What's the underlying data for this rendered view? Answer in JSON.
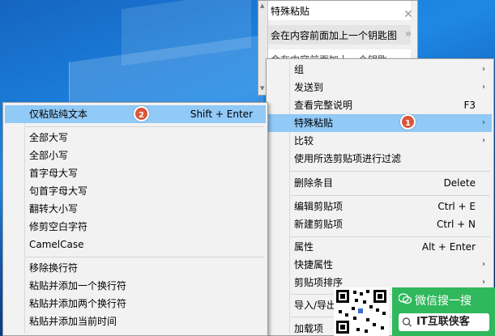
{
  "clipboard_panel": {
    "items": [
      {
        "text": "特殊粘贴"
      },
      {
        "text": "会在内容前面加上一个钥匙图"
      },
      {
        "text": "会在内容前面加上一个钥匙"
      }
    ],
    "close_symbol": "✕",
    "expand_symbol": "»"
  },
  "context_menu": {
    "items": [
      {
        "label": "组",
        "submenu": true
      },
      {
        "label": "发送到",
        "submenu": true
      },
      {
        "label": "查看完整说明",
        "shortcut": "F3"
      },
      {
        "label": "特殊粘贴",
        "submenu": true,
        "highlighted": true,
        "badge": "1"
      },
      {
        "label": "比较",
        "submenu": true
      },
      {
        "label": "使用所选剪贴项进行过滤"
      },
      {
        "label": "删除条目",
        "shortcut": "Delete"
      },
      {
        "label": "编辑剪贴项",
        "shortcut": "Ctrl + E"
      },
      {
        "label": "新建剪贴项",
        "shortcut": "Ctrl + N"
      },
      {
        "label": "属性",
        "shortcut": "Alt + Enter"
      },
      {
        "label": "快捷属性",
        "submenu": true
      },
      {
        "label": "剪贴项排序",
        "submenu": true
      },
      {
        "label": "导入/导出"
      },
      {
        "label": "加载项"
      }
    ]
  },
  "paste_submenu": {
    "items": [
      {
        "label": "仅粘贴纯文本",
        "shortcut": "Shift + Enter",
        "highlighted": true,
        "badge": "2"
      },
      {
        "label": "全部大写"
      },
      {
        "label": "全部小写"
      },
      {
        "label": "首字母大写"
      },
      {
        "label": "句首字母大写"
      },
      {
        "label": "翻转大小写"
      },
      {
        "label": "修剪空白字符"
      },
      {
        "label": "CamelCase"
      },
      {
        "label": "移除换行符"
      },
      {
        "label": "粘贴并添加一个换行符"
      },
      {
        "label": "粘贴并添加两个换行符"
      },
      {
        "label": "粘贴并添加当前时间"
      }
    ]
  },
  "watermark": {
    "top_text": "微信搜一搜",
    "bottom_text": "IT互联侠客"
  },
  "colors": {
    "highlight": "#91c9f7",
    "badge": "#d9553a",
    "watermark_green": "#2fb85c"
  }
}
